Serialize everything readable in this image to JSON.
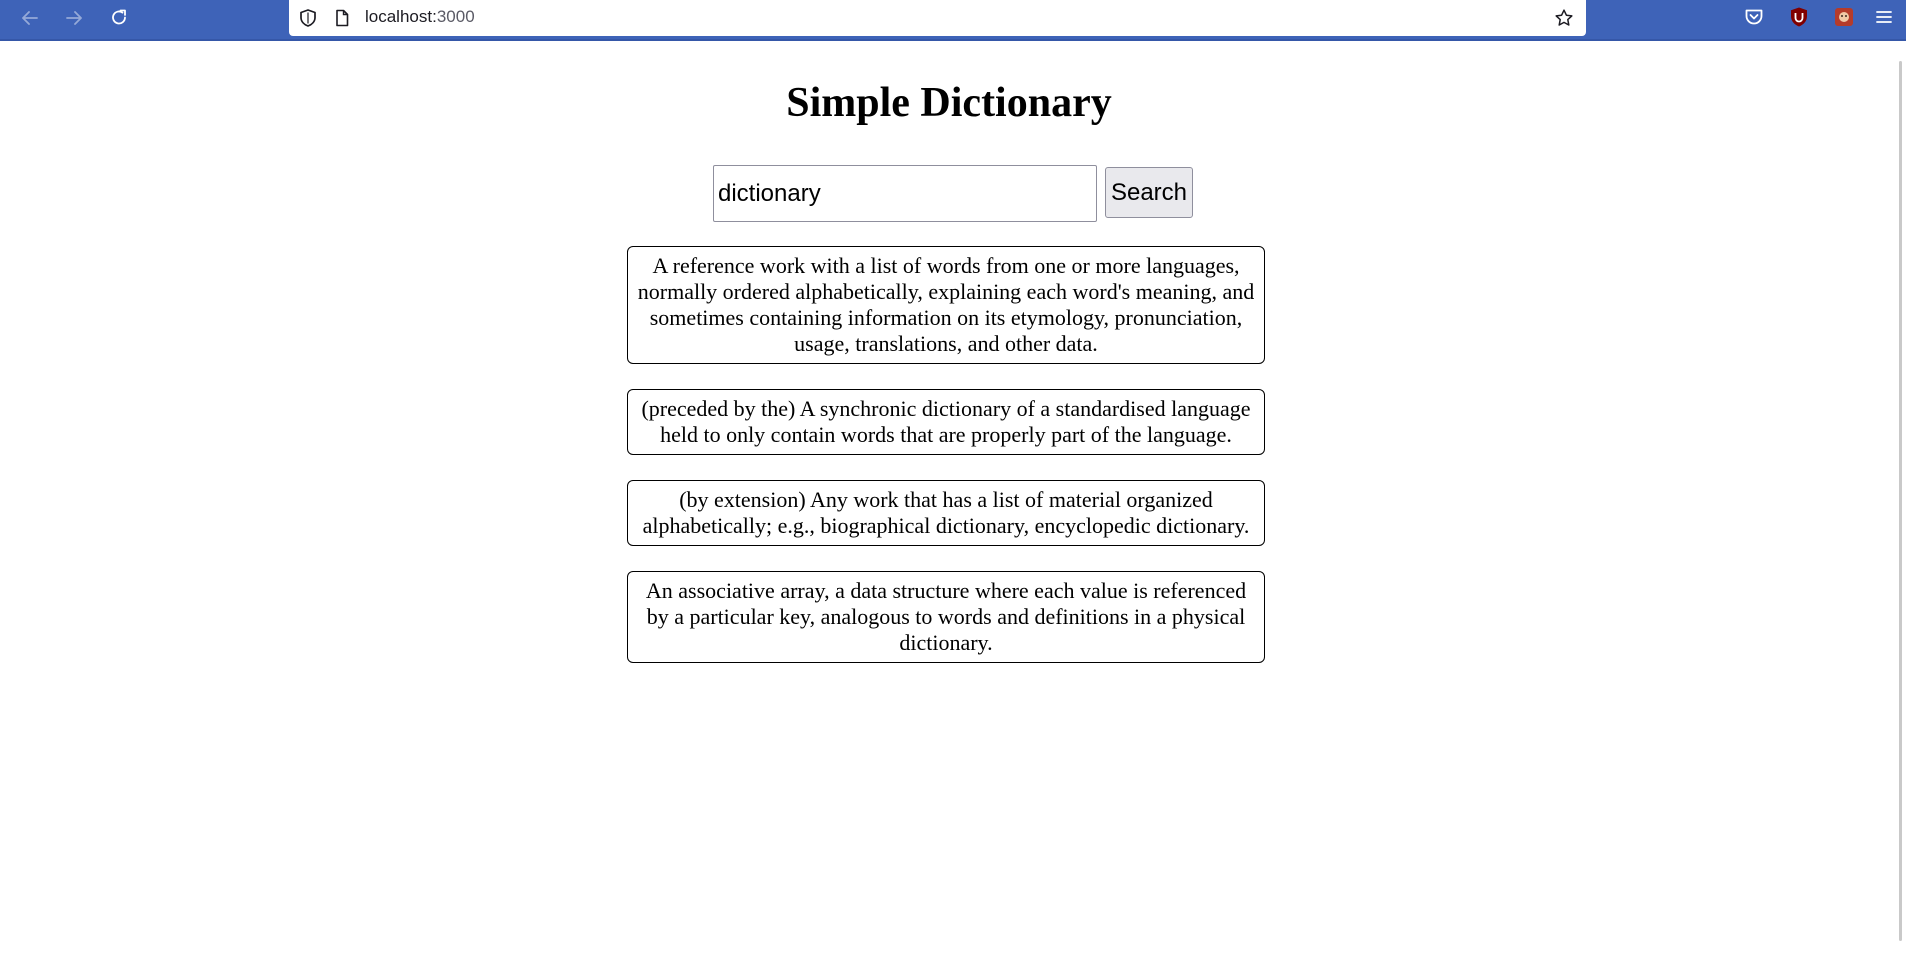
{
  "browser": {
    "url_host": "localhost:",
    "url_port": "3000",
    "icons": {
      "back": "arrow-left-icon",
      "forward": "arrow-right-icon",
      "reload": "reload-icon",
      "tracking": "shield-icon",
      "page_info": "page-icon",
      "bookmark": "star-icon",
      "pocket": "pocket-icon",
      "ublock": "ublock-origin-icon",
      "extension": "extension-icon",
      "menu": "hamburger-menu-icon"
    },
    "colors": {
      "toolbar": "#3e63b8"
    }
  },
  "app": {
    "title": "Simple Dictionary",
    "search": {
      "value": "dictionary",
      "button_label": "Search"
    },
    "definitions": [
      "A reference work with a list of words from one or more languages, normally ordered alphabetically, explaining each word's meaning, and sometimes containing information on its etymology, pronunciation, usage, translations, and other data.",
      "(preceded by the) A synchronic dictionary of a standardised language held to only contain words that are properly part of the language.",
      "(by extension) Any work that has a list of material organized alphabetically; e.g., biographical dictionary, encyclopedic dictionary.",
      "An associative array, a data structure where each value is referenced by a particular key, analogous to words and definitions in a physical dictionary."
    ]
  }
}
